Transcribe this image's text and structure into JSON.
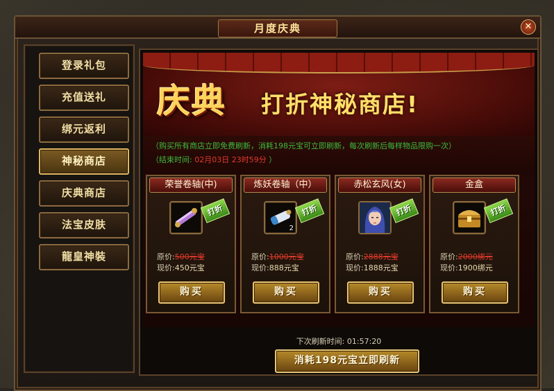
{
  "window": {
    "title": "月度庆典",
    "close_glyph": "✕"
  },
  "sidebar": {
    "items": [
      {
        "label": "登录礼包",
        "active": false
      },
      {
        "label": "充值送礼",
        "active": false
      },
      {
        "label": "绑元返利",
        "active": false
      },
      {
        "label": "神秘商店",
        "active": true
      },
      {
        "label": "庆典商店",
        "active": false
      },
      {
        "label": "法宝皮肤",
        "active": false
      },
      {
        "label": "龍皇神裝",
        "active": false
      }
    ]
  },
  "banner": {
    "big_text": "庆典",
    "sub_text": "打折神秘商店!"
  },
  "info": {
    "line1": "（购买所有商店立即免费刷新，消耗198元宝可立即刷新，每次刷新后每样物品限购一次）",
    "end_label": "（结束时间:",
    "end_date": "02月03日",
    "end_time": "23时59分",
    "end_close": "）"
  },
  "shop": {
    "tag_label": "打折",
    "orig_label": "原价:",
    "now_label": "现价:",
    "buy_label": "购买",
    "items": [
      {
        "name": "荣誉卷轴(中)",
        "icon": "scroll-purple-icon",
        "qty": "",
        "orig_price": "500元宝",
        "now_price": "450元宝"
      },
      {
        "name": "炼妖卷轴（中）",
        "icon": "scroll-blue-icon",
        "qty": "2",
        "orig_price": "1000元宝",
        "now_price": "888元宝"
      },
      {
        "name": "赤松玄风(女)",
        "icon": "female-portrait-icon",
        "qty": "",
        "orig_price": "2888元宝",
        "now_price": "1888元宝"
      },
      {
        "name": "金盒",
        "icon": "gold-chest-icon",
        "qty": "",
        "orig_price": "2000绑元",
        "now_price": "1900绑元"
      }
    ]
  },
  "refresh": {
    "label": "下次刷新时间:",
    "time": "01:57:20",
    "button_label": "消耗198元宝立即刷新"
  }
}
